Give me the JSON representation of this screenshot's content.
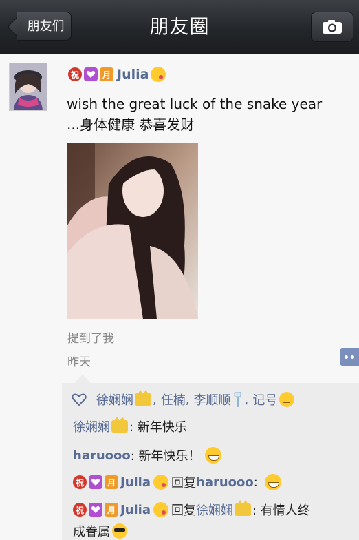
{
  "navbar": {
    "back_label": "朋友们",
    "title": "朋友圈",
    "camera_icon": "camera-icon"
  },
  "post": {
    "author_name": "Julia",
    "badges": {
      "zhu": "祝",
      "yue": "月"
    },
    "text_line1": "wish the great luck of the snake year",
    "text_line2": "...身体健康 恭喜发财",
    "mention": "提到了我",
    "time": "昨天"
  },
  "likes": {
    "names": [
      "徐娴娴",
      "任楠",
      "李顺顺",
      "记号"
    ],
    "separator": ","
  },
  "comments": [
    {
      "author": "徐娴娴",
      "text": ": 新年快乐"
    },
    {
      "author": "haruooo",
      "text": ": 新年快乐！"
    },
    {
      "author": "Julia",
      "reply_word": "回复",
      "reply_to": "haruooo",
      "text": ":"
    },
    {
      "author": "Julia",
      "reply_word": "回复",
      "reply_to": "徐娴娴",
      "text": ": 有情人终",
      "text_cont": "成眷属"
    }
  ],
  "colors": {
    "link": "#576b95",
    "nav_bg": "#2a2d31",
    "comments_bg": "#ececec"
  }
}
